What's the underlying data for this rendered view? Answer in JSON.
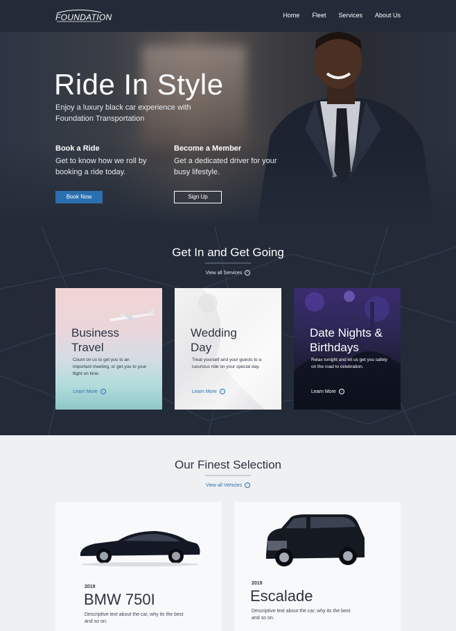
{
  "header": {
    "logo": "FOUNDATION",
    "nav": [
      "Home",
      "Fleet",
      "Services",
      "About Us"
    ]
  },
  "hero": {
    "title": "Ride In Style",
    "subtitle": "Enjoy a luxury black car experience with Foundation Transportation",
    "col1": {
      "heading": "Book a Ride",
      "text": "Get to know how we roll by booking a ride today.",
      "button": "Book Now"
    },
    "col2": {
      "heading": "Become a Member",
      "text": "Get a dedicated driver for your busy lifestyle.",
      "button": "Sign Up"
    }
  },
  "services": {
    "title": "Get In and Get Going",
    "link": "View all Services",
    "cards": [
      {
        "title": "Business Travel",
        "desc": "Count on us to get you to an important meeting, or get you to your flight on time.",
        "link": "Learn More"
      },
      {
        "title": "Wedding Day",
        "desc": "Treat yourself and your guests to a luxurious ride on your special day.",
        "link": "Learn More"
      },
      {
        "title": "Date Nights & Birthdays",
        "desc": "Relax tonight and let us get you safely on the road to celebration.",
        "link": "Learn More"
      }
    ]
  },
  "vehicles": {
    "title": "Our Finest Selection",
    "link": "View all Vehicles",
    "cards": [
      {
        "year": "2019",
        "name": "BMW 750I",
        "desc": "Descriptive text about the car, why its the best and so on."
      },
      {
        "year": "2019",
        "name": "Escalade",
        "desc": "Descriptive text about the car, why its the best and so on."
      }
    ]
  },
  "colors": {
    "navy": "#232b38",
    "accent": "#2a6fb0",
    "light": "#eef0f2"
  }
}
